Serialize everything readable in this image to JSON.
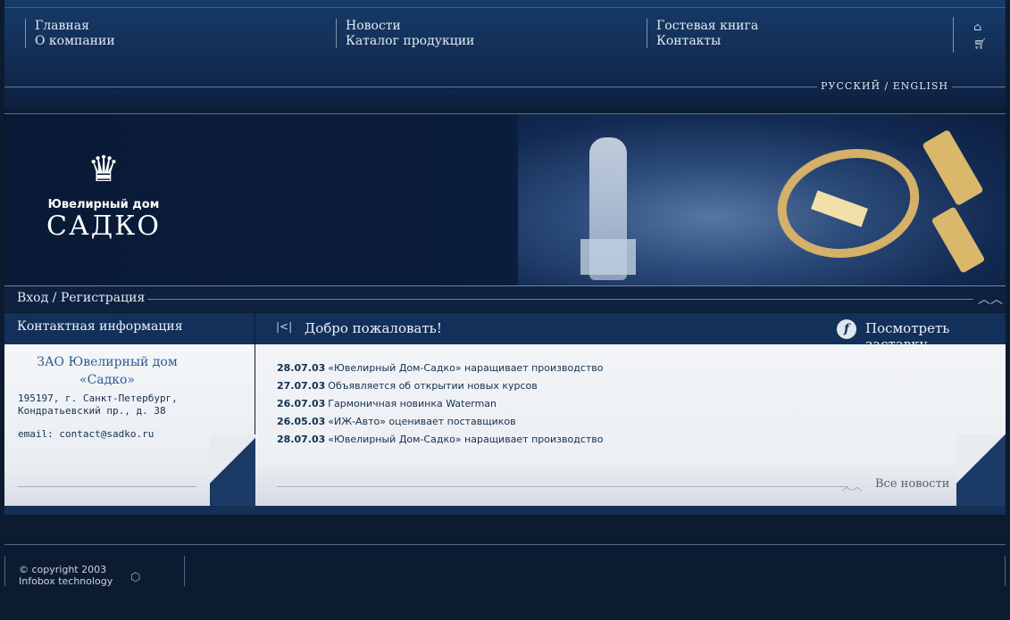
{
  "nav": {
    "col1": [
      "Главная",
      "О компании"
    ],
    "col2": [
      "Новости",
      "Каталог продукции"
    ],
    "col3": [
      "Гостевая книга",
      "Контакты"
    ]
  },
  "icons": {
    "home": "home-icon",
    "cart": "cart-icon"
  },
  "lang": {
    "ru": "РУССКИЙ",
    "sep": "/",
    "en": "ENGLISH"
  },
  "logo": {
    "line1": "Ювелирный дом",
    "line2": "САДКО"
  },
  "login": {
    "label": "Вход / Регистрация"
  },
  "contact": {
    "heading": "Контактная информация",
    "company_line1": "ЗАО Ювелирный дом",
    "company_line2": "«Садко»",
    "address_line1": "195197, г. Санкт-Петербург,",
    "address_line2": "Кондратьевский пр., д. 38",
    "email": "email: contact@sadko.ru"
  },
  "welcome": {
    "heading": "Добро пожаловать!",
    "intro_link": "Посмотреть заставку",
    "news": [
      {
        "date": "28.07.03",
        "title": "«Ювелирный Дом-Садко» наращивает производство"
      },
      {
        "date": "27.07.03",
        "title": "Объявляется об открытии новых курсов"
      },
      {
        "date": "26.07.03",
        "title": "Гармоничная новинка Waterman"
      },
      {
        "date": "26.05.03",
        "title": "«ИЖ-Авто» оценивает поставщиков"
      },
      {
        "date": "28.07.03",
        "title": "«Ювелирный Дом-Садко» наращивает производство"
      }
    ],
    "all_news": "Все новости"
  },
  "footer": {
    "copyright_line1": "© copyright 2003",
    "copyright_line2": "Infobox technology"
  },
  "colors": {
    "header": "#163a68",
    "panel_head": "#12305a",
    "background": "#0d1b30",
    "text_dark": "#14304f",
    "company": "#2f5a92"
  }
}
